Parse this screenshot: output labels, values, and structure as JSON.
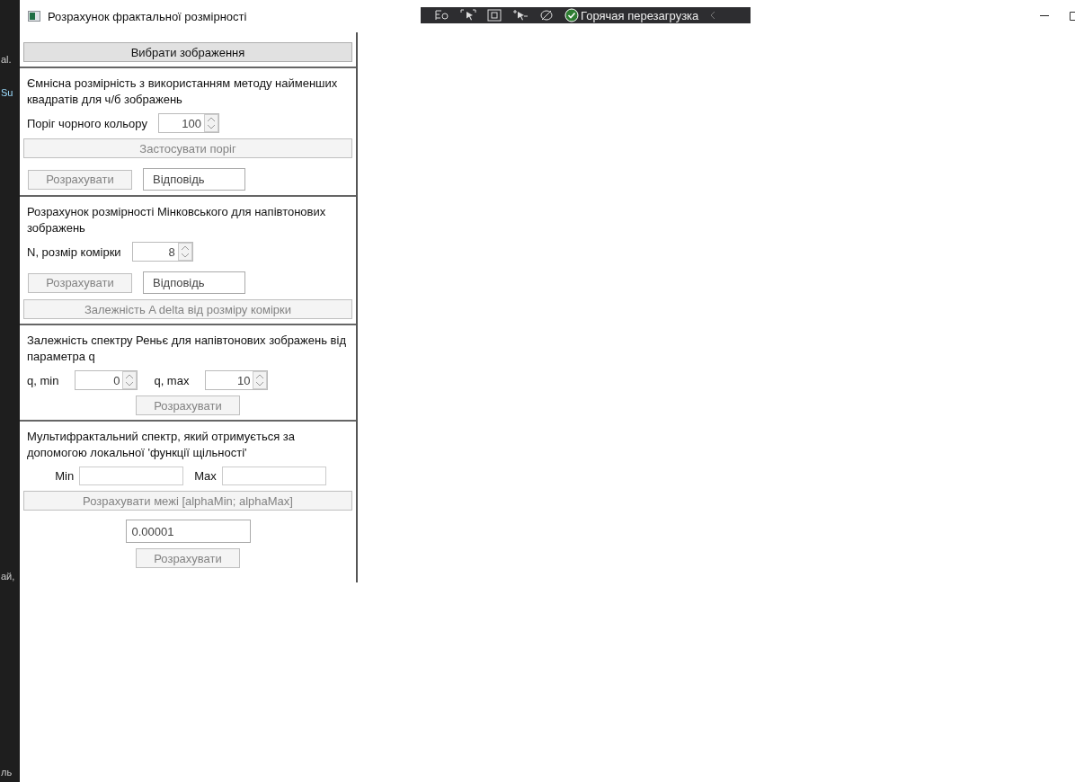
{
  "background_app": {
    "fragments": [
      "al.",
      "Su",
      "ай,",
      "ль"
    ]
  },
  "debug_toolbar": {
    "label": "Горячая перезагрузка"
  },
  "window": {
    "title": "Розрахунок фрактальної розмірності"
  },
  "select_image_button": {
    "label": "Вибрати зображення",
    "disabled": false
  },
  "sections": [
    {
      "title": "Ємнісна розмірність з використанням методу найменших квадратів для ч/б зображень",
      "elements": [
        {
          "kind": "spin",
          "label": "Поріг чорного кольору",
          "value": "100"
        },
        {
          "kind": "wide_button",
          "label": "Застосувати поріг",
          "disabled": true
        },
        {
          "kind": "calc_answer",
          "button": {
            "label": "Розрахувати",
            "disabled": true
          },
          "answer": "Відповідь"
        }
      ]
    },
    {
      "title": "Розрахунок розмірності Мінковського для напівтонових зображень",
      "elements": [
        {
          "kind": "spin",
          "label": "N, розмір комірки",
          "value": "8"
        },
        {
          "kind": "calc_answer",
          "button": {
            "label": "Розрахувати",
            "disabled": true
          },
          "answer": "Відповідь"
        },
        {
          "kind": "wide_button",
          "label": "Залежність A delta від розміру комірки",
          "disabled": true
        }
      ]
    },
    {
      "title": "Залежність спектру Реньє для напівтонових зображень від параметра q",
      "elements": [
        {
          "kind": "spin_pair",
          "items": [
            {
              "label": "q, min",
              "value": "0"
            },
            {
              "label": "q, max",
              "value": "10"
            }
          ]
        },
        {
          "kind": "center_button",
          "label": "Розрахувати",
          "disabled": true
        }
      ]
    },
    {
      "title": "Мультифрактальний спектр, який отримується за допомогою локальної 'функції щільності'",
      "elements": [
        {
          "kind": "min_max",
          "items": [
            {
              "label": "Min"
            },
            {
              "label": "Max"
            }
          ]
        },
        {
          "kind": "wide_button",
          "label": "Розрахувати межі [alphaMin; alphaMax]",
          "disabled": true
        },
        {
          "kind": "center_input",
          "value": "0.00001"
        },
        {
          "kind": "center_button",
          "label": "Розрахувати",
          "disabled": true
        }
      ]
    }
  ]
}
